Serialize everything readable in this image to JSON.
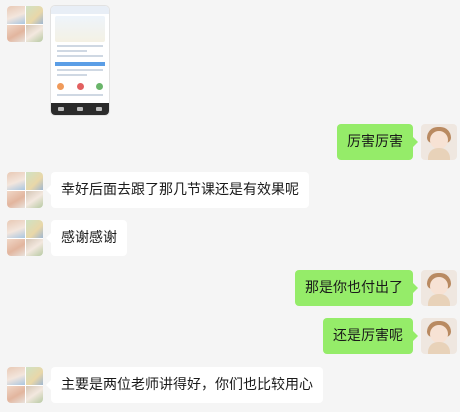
{
  "messages": [
    {
      "side": "left",
      "type": "image",
      "avatar": "group-avatar"
    },
    {
      "side": "right",
      "type": "text",
      "text": "厉害厉害",
      "avatar": "user-avatar"
    },
    {
      "side": "left",
      "type": "text",
      "text": "幸好后面去跟了那几节课还是有效果呢",
      "avatar": "group-avatar"
    },
    {
      "side": "left",
      "type": "text",
      "text": "感谢感谢",
      "avatar": "group-avatar"
    },
    {
      "side": "right",
      "type": "text",
      "text": "那是你也付出了",
      "avatar": "user-avatar"
    },
    {
      "side": "right",
      "type": "text",
      "text": "还是厉害呢",
      "avatar": "user-avatar"
    },
    {
      "side": "left",
      "type": "text",
      "text": "主要是两位老师讲得好，你们也比较用心",
      "avatar": "group-avatar"
    }
  ],
  "colors": {
    "background": "#f5f5f5",
    "bubble_left": "#ffffff",
    "bubble_right": "#95ec69",
    "text": "#1a1a1a"
  }
}
